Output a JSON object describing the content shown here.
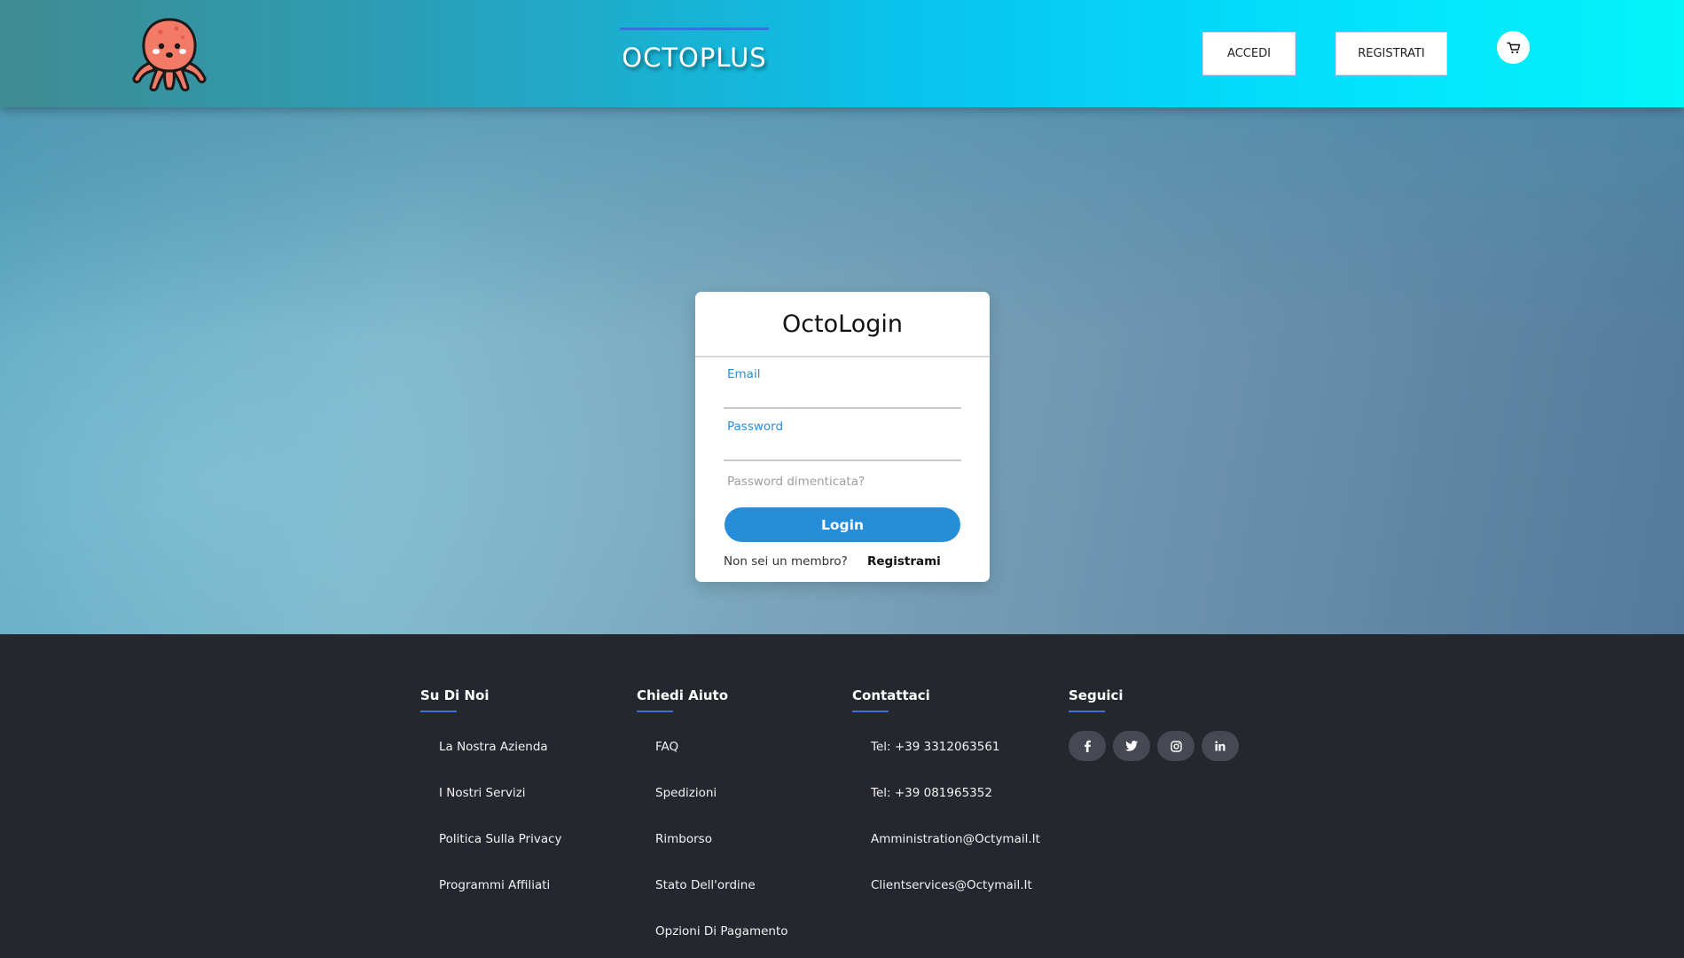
{
  "header": {
    "brand": "OCTOPLUS",
    "accedi_label": "ACCEDI",
    "registrati_label": "REGISTRATI"
  },
  "login": {
    "title": "OctoLogin",
    "email_label": "Email",
    "password_label": "Password",
    "forgot_label": "Password dimenticata?",
    "login_button": "Login",
    "not_member": "Non sei un membro?",
    "register_link": "Registrami"
  },
  "footer": {
    "columns": [
      {
        "title": "Su Di Noi",
        "items": [
          "La Nostra Azienda",
          "I Nostri Servizi",
          "Politica Sulla Privacy",
          "Programmi Affiliati"
        ]
      },
      {
        "title": "Chiedi Aiuto",
        "items": [
          "FAQ",
          "Spedizioni",
          "Rimborso",
          "Stato Dell'ordine",
          "Opzioni Di Pagamento"
        ]
      },
      {
        "title": "Contattaci",
        "items": [
          "Tel: +39 3312063561",
          "Tel: +39 081965352",
          "Amministration@Octymail.It",
          "Clientservices@Octymail.It"
        ]
      },
      {
        "title": "Seguici"
      }
    ],
    "socials": [
      {
        "icon": "facebook-icon",
        "glyph": "f"
      },
      {
        "icon": "twitter-icon",
        "glyph": "t"
      },
      {
        "icon": "instagram-icon",
        "glyph": "◎"
      },
      {
        "icon": "linkedin-icon",
        "glyph": "in"
      }
    ]
  },
  "colors": {
    "accent_blue": "#3d6fe3",
    "login_button": "#268dd9",
    "label_blue": "#2a8fd8",
    "footer_bg": "#25272e"
  }
}
